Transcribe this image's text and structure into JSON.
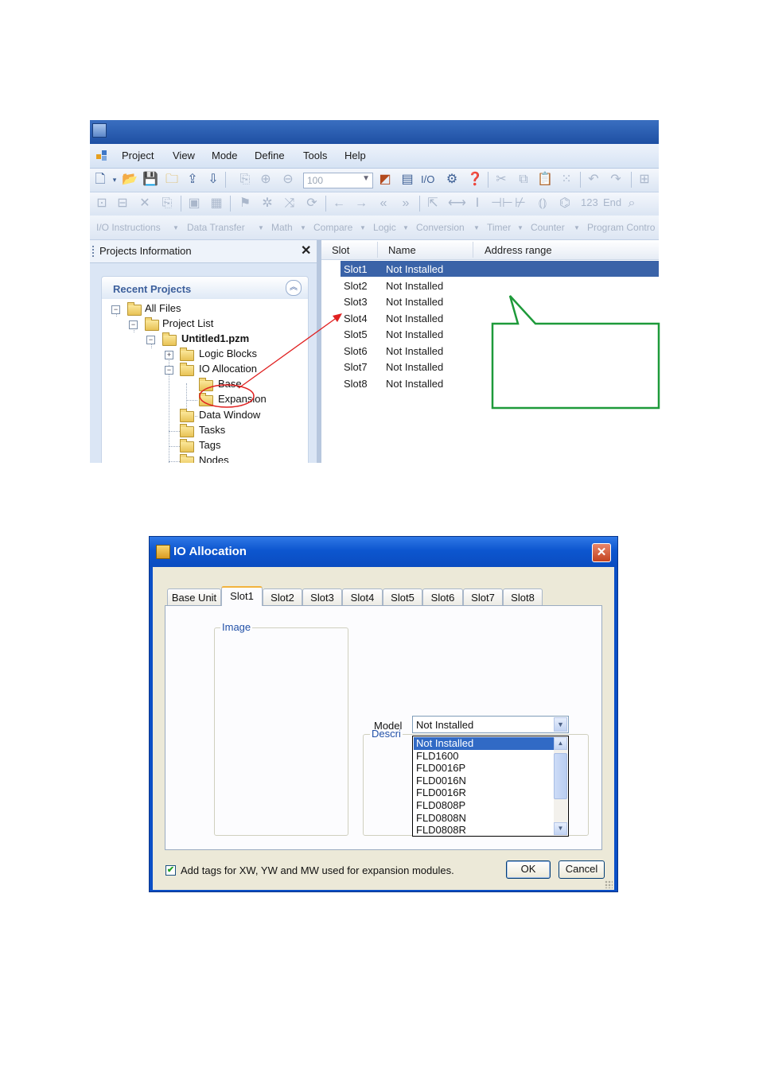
{
  "app": {
    "menu": [
      "Project",
      "View",
      "Mode",
      "Define",
      "Tools",
      "Help"
    ],
    "zoom_value": "100",
    "io_label": "I/O",
    "ladder_123": "123",
    "ladder_end": "End",
    "instruction_tabs": [
      "I/O Instructions",
      "Data Transfer",
      "Math",
      "Compare",
      "Logic",
      "Conversion",
      "Timer",
      "Counter",
      "Program Contro"
    ],
    "projects_panel": {
      "title": "Projects Information",
      "close": "✕",
      "recent_title": "Recent Projects",
      "tree": {
        "all_files": "All Files",
        "project_list": "Project List",
        "project": "Untitled1.pzm",
        "logic_blocks": "Logic Blocks",
        "io_allocation": "IO Allocation",
        "base": "Base",
        "expansion": "Expansion",
        "data_window": "Data Window",
        "tasks": "Tasks",
        "tags": "Tags",
        "nodes": "Nodes"
      }
    },
    "slot_grid": {
      "columns": [
        "Slot",
        "Name",
        "Address range"
      ],
      "rows": [
        {
          "slot": "Slot1",
          "name": "Not Installed"
        },
        {
          "slot": "Slot2",
          "name": "Not Installed"
        },
        {
          "slot": "Slot3",
          "name": "Not Installed"
        },
        {
          "slot": "Slot4",
          "name": "Not Installed"
        },
        {
          "slot": "Slot5",
          "name": "Not Installed"
        },
        {
          "slot": "Slot6",
          "name": "Not Installed"
        },
        {
          "slot": "Slot7",
          "name": "Not Installed"
        },
        {
          "slot": "Slot8",
          "name": "Not Installed"
        }
      ],
      "selected_index": 0
    }
  },
  "dialog": {
    "title": "IO Allocation",
    "close": "✕",
    "tabs": [
      "Base Unit",
      "Slot1",
      "Slot2",
      "Slot3",
      "Slot4",
      "Slot5",
      "Slot6",
      "Slot7",
      "Slot8"
    ],
    "active_tab": "Slot1",
    "image_group_label": "Image",
    "description_group_label": "Descri",
    "model_label": "Model",
    "model_value": "Not Installed",
    "model_options": [
      "Not Installed",
      "FLD1600",
      "FLD0016P",
      "FLD0016N",
      "FLD0016R",
      "FLD0808P",
      "FLD0808N",
      "FLD0808R"
    ],
    "add_tags_label": "Add tags for XW, YW and MW used for expansion  modules.",
    "add_tags_checked": true,
    "ok_label": "OK",
    "cancel_label": "Cancel"
  },
  "colors": {
    "selection": "#3a63a8",
    "dialog_title": "#0b4fc6",
    "annotation_arrow": "#e02020",
    "callout_border": "#1e9a3a"
  }
}
